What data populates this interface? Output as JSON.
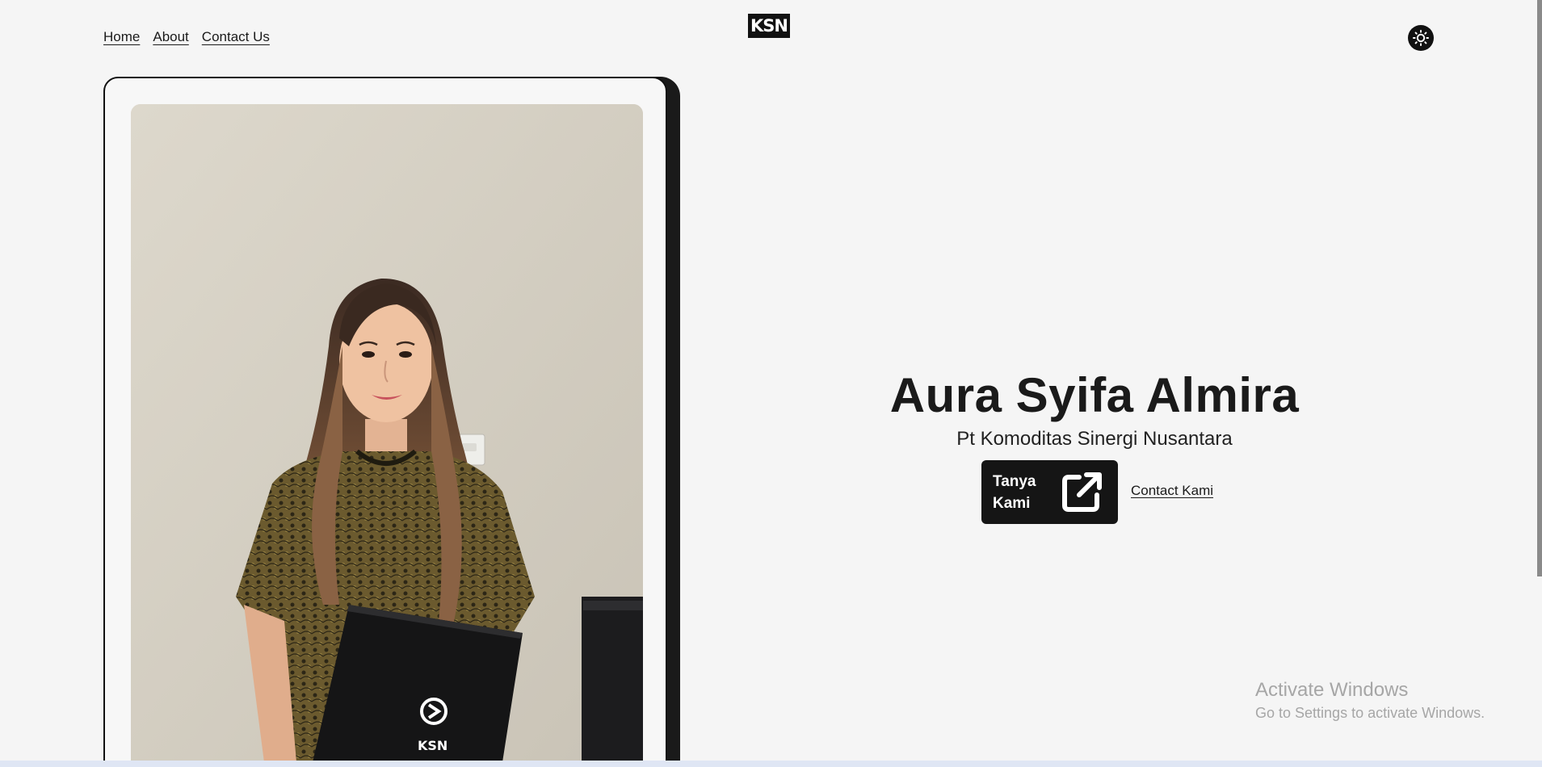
{
  "header": {
    "nav": [
      {
        "label": "Home"
      },
      {
        "label": "About"
      },
      {
        "label": "Contact Us"
      }
    ],
    "logo_text": "KSN",
    "theme_toggle_icon": "sun-icon"
  },
  "profile": {
    "photo_logo_text": "KSN",
    "name": "Aura Syifa Almira",
    "company": "Pt Komoditas Sinergi Nusantara",
    "ask_button_label": "Tanya Kami",
    "ask_button_icon": "external-link-icon",
    "contact_link_label": "Contact Kami"
  },
  "watermark": {
    "title": "Activate Windows",
    "subtitle": "Go to Settings to activate Windows."
  },
  "colors": {
    "background": "#f5f5f5",
    "primary": "#151515",
    "watermark": "#a6a6a6"
  }
}
